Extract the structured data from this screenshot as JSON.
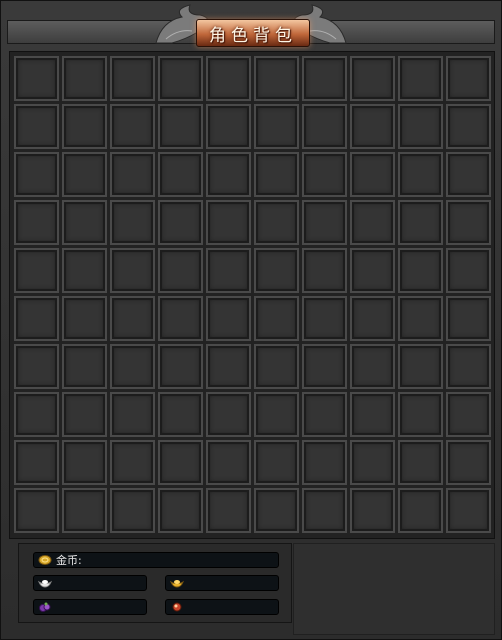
{
  "window": {
    "title": "角色背包"
  },
  "inventory": {
    "rows": 10,
    "columns": 10,
    "slots": [
      [
        null,
        null,
        null,
        null,
        null,
        null,
        null,
        null,
        null,
        null
      ],
      [
        null,
        null,
        null,
        null,
        null,
        null,
        null,
        null,
        null,
        null
      ],
      [
        null,
        null,
        null,
        null,
        null,
        null,
        null,
        null,
        null,
        null
      ],
      [
        null,
        null,
        null,
        null,
        null,
        null,
        null,
        null,
        null,
        null
      ],
      [
        null,
        null,
        null,
        null,
        null,
        null,
        null,
        null,
        null,
        null
      ],
      [
        null,
        null,
        null,
        null,
        null,
        null,
        null,
        null,
        null,
        null
      ],
      [
        null,
        null,
        null,
        null,
        null,
        null,
        null,
        null,
        null,
        null
      ],
      [
        null,
        null,
        null,
        null,
        null,
        null,
        null,
        null,
        null,
        null
      ],
      [
        null,
        null,
        null,
        null,
        null,
        null,
        null,
        null,
        null,
        null
      ],
      [
        null,
        null,
        null,
        null,
        null,
        null,
        null,
        null,
        null,
        null
      ]
    ]
  },
  "currency": {
    "gold_label": "金币:",
    "gold_value": "",
    "silver_value": "",
    "ingot_value": "",
    "gem_value": "",
    "orb_value": "",
    "icons": {
      "gold": "gold-coin-icon",
      "silver": "silver-ingot-icon",
      "ingot": "gold-ingot-icon",
      "gem": "purple-gem-icon",
      "orb": "red-orb-icon"
    }
  },
  "colors": {
    "title_plate": "#c0673a",
    "panel_bg": "#2c2c2c",
    "slot_bg": "#343434"
  }
}
